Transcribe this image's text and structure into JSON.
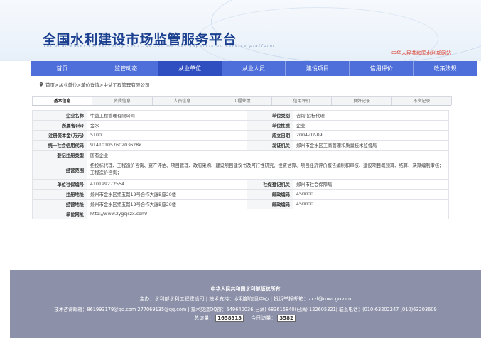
{
  "header": {
    "title": "全国水利建设市场监管服务平台",
    "subtitle": "National water conservancy construction market supervision service platform",
    "ministry_link": "中华人民共和国水利部网站"
  },
  "nav": {
    "items": [
      "首页",
      "监管动态",
      "从业单位",
      "从业人员",
      "建设项目",
      "信用评价",
      "政策法规"
    ],
    "active_index": 2
  },
  "breadcrumb": "首页>从业单位>单位详情>中益工程管理有限公司",
  "tabs": {
    "items": [
      "基本信息",
      "资质信息",
      "人员信息",
      "工程业绩",
      "信用评价",
      "良好记录",
      "不良记录"
    ],
    "active_index": 0
  },
  "info": {
    "company_name_label": "企业名称",
    "company_name": "中益工程管理有限公司",
    "unit_type_label": "单位类别",
    "unit_type": "咨询,招标代理",
    "province_label": "所属省(市)",
    "province": "金水",
    "unit_nature_label": "单位性质",
    "unit_nature": "企业",
    "capital_label": "注册资本金(万元)",
    "capital": "5100",
    "founded_label": "成立日期",
    "founded": "2004-02-09",
    "credit_code_label": "统一社会信用代码",
    "credit_code": "91410105760203628k",
    "issuer_label": "发证机关",
    "issuer": "郑州市金水区工商管理和质量技术监督局",
    "reg_type_label": "登记注册类型",
    "reg_type": "国有企业",
    "scope_label": "经营范围",
    "scope": "招投标代理、工程造价咨询、资产评估、项目管理、政府采购、建设项目建议书及可行性研究、投资估算、项目经济评价报告编制和审核、建设项目概预算、结算、决算编制审核；工程造价咨询；",
    "insurance_no_label": "单位社保编号",
    "insurance_no": "410199272554",
    "insurance_org_label": "社保登记机关",
    "insurance_org": "郑州市社会保障局",
    "reg_address_label": "注册地址",
    "reg_address": "郑州市金水区纬五路12号合作大厦B座20楼",
    "postcode1_label": "邮政编码",
    "postcode1": "450000",
    "biz_address_label": "经营地址",
    "biz_address": "郑州市金水区纬五路12号合作大厦B座20楼",
    "postcode2_label": "邮政编码",
    "postcode2": "450000",
    "website_label": "单位网址",
    "website": "http://www.zygcjszx.com/"
  },
  "footer": {
    "copyright": "中华人民共和国水利部版权所有",
    "line2": "主办：水利部水利工程建设司 | 技术支持：水利部信息中心 | 投诉举报邮箱：zxzl@mwr.gov.cn",
    "line3": "技术咨询邮箱：861993179@qq.com 277069135@qq.com | 技术交流QQ群：549640036(已满) 683615840(已满) 122605321| 联系电话：(010)63202247 (010)63203609",
    "total_label": "总访量：",
    "total_value": "1658313",
    "today_label": "今日访量：",
    "today_value": "3582"
  }
}
